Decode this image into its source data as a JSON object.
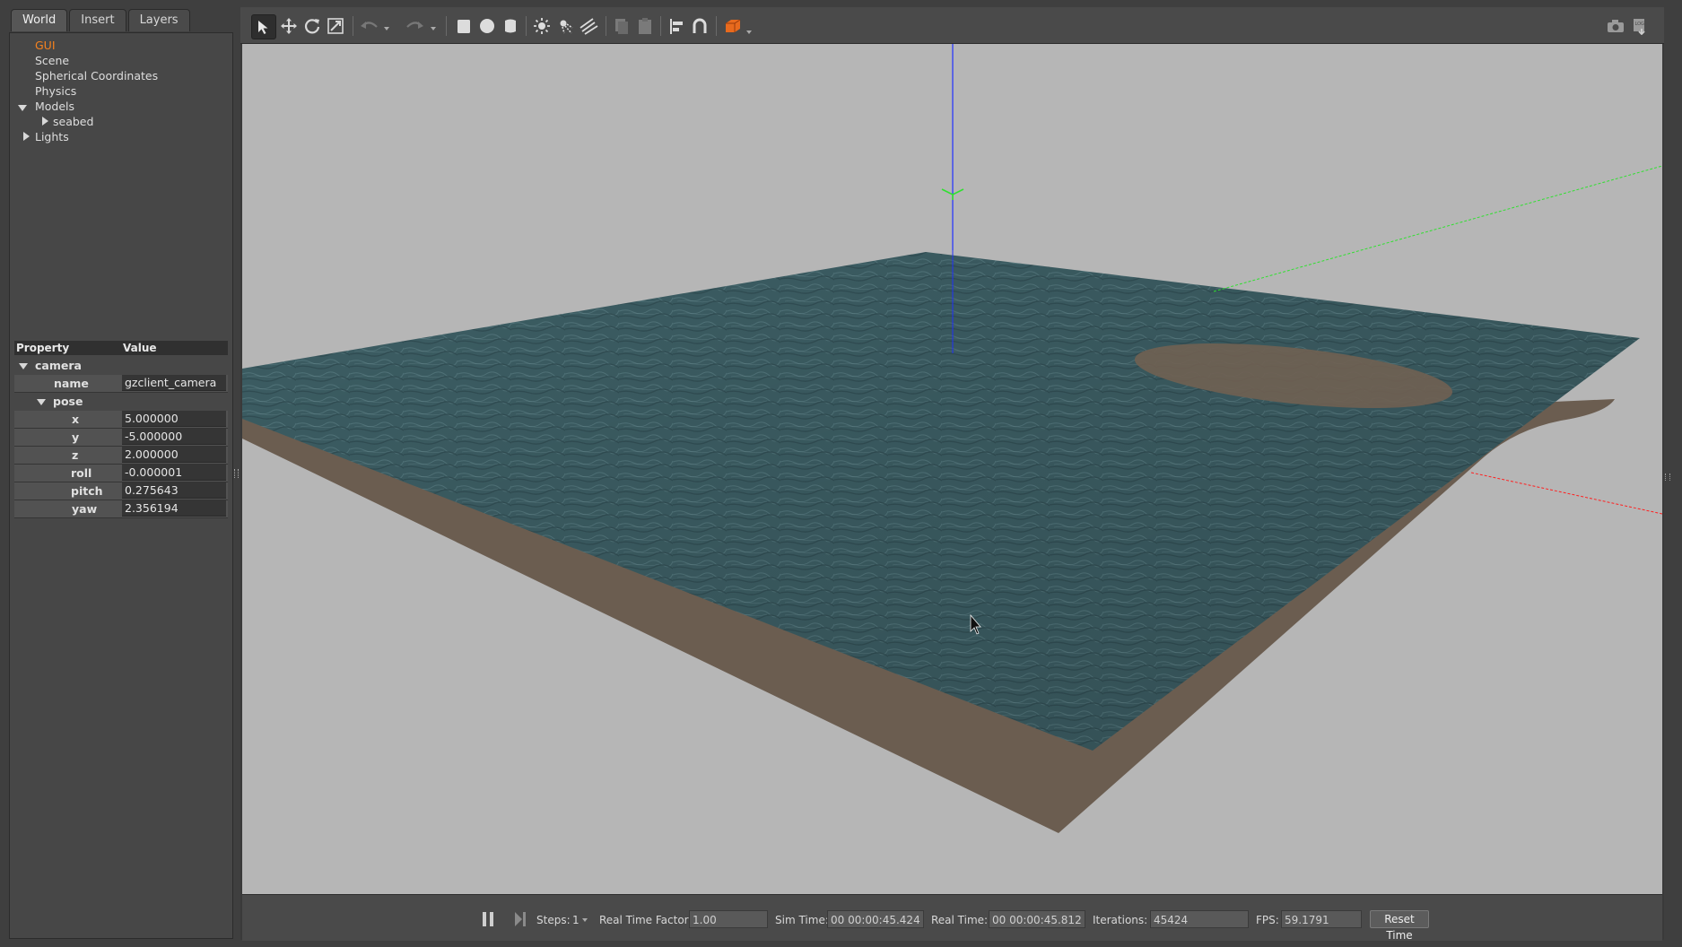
{
  "tabs": [
    "World",
    "Insert",
    "Layers"
  ],
  "world_tree": {
    "gui": "GUI",
    "scene": "Scene",
    "spherical": "Spherical Coordinates",
    "physics": "Physics",
    "models": "Models",
    "seabed": "seabed",
    "lights": "Lights"
  },
  "properties": {
    "header_property": "Property",
    "header_value": "Value",
    "camera": "camera",
    "name_key": "name",
    "name_value": "gzclient_camera",
    "pose": "pose",
    "x_key": "x",
    "x_value": "5.000000",
    "y_key": "y",
    "y_value": "-5.000000",
    "z_key": "z",
    "z_value": "2.000000",
    "roll_key": "roll",
    "roll_value": "-0.000001",
    "pitch_key": "pitch",
    "pitch_value": "0.275643",
    "yaw_key": "yaw",
    "yaw_value": "2.356194"
  },
  "toolbar_icons": [
    "select-arrow-icon",
    "translate-icon",
    "rotate-icon",
    "scale-icon",
    "undo-icon",
    "redo-icon",
    "box-icon",
    "sphere-icon",
    "cylinder-icon",
    "point-light-icon",
    "spot-light-icon",
    "directional-light-icon",
    "copy-icon",
    "paste-icon",
    "align-icon",
    "snap-icon",
    "view-angle-icon",
    "screenshot-icon",
    "log-icon"
  ],
  "bottom_bar": {
    "steps_label": "Steps:",
    "steps_value": "1",
    "rtf_label": "Real Time Factor:",
    "rtf_value": "1.00",
    "sim_time_label": "Sim Time:",
    "sim_time_value": "00 00:00:45.424",
    "real_time_label": "Real Time:",
    "real_time_value": "00 00:00:45.812",
    "iterations_label": "Iterations:",
    "iterations_value": "45424",
    "fps_label": "FPS:",
    "fps_value": "59.1791",
    "reset_label": "Reset Time"
  },
  "colors": {
    "accent": "#f5821f",
    "water": "#3c5d63",
    "seabed": "#6b5d50",
    "sky": "#b6b6b6",
    "x_axis": "#ff2020",
    "y_axis": "#30e030",
    "z_axis": "#2030ff"
  }
}
